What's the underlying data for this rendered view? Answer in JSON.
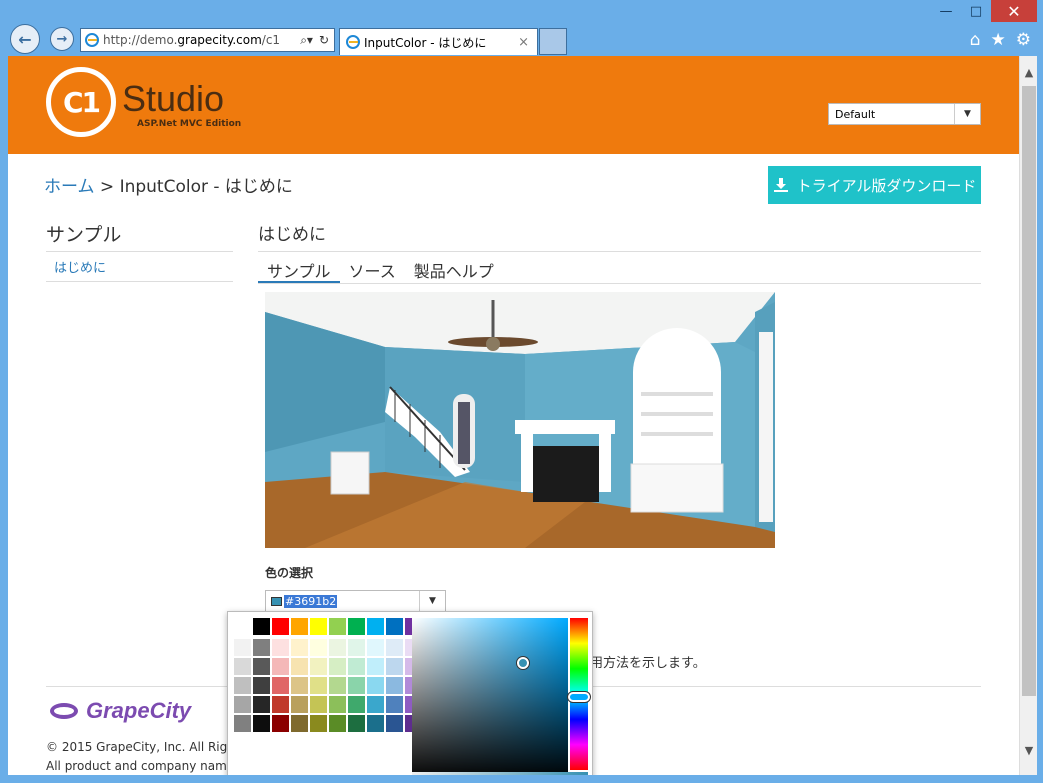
{
  "browser": {
    "url_prefix": "http://demo.",
    "url_domain": "grapecity.com",
    "url_suffix": "/c1",
    "tab_title": "InputColor - はじめに",
    "tab_close": "×"
  },
  "header": {
    "logo_mark": "C1",
    "logo_text": "Studio",
    "logo_edition": "ASP.Net MVC Edition",
    "theme_value": "Default"
  },
  "breadcrumb": {
    "home": "ホーム",
    "separator": " > ",
    "current": "InputColor - はじめに"
  },
  "download_button": "トライアル版ダウンロード",
  "sidebar": {
    "title": "サンプル",
    "items": [
      {
        "label": "はじめに"
      }
    ]
  },
  "main": {
    "title": "はじめに",
    "tabs": [
      {
        "label": "サンプル",
        "active": true
      },
      {
        "label": "ソース",
        "active": false
      },
      {
        "label": "製品ヘルプ",
        "active": false
      }
    ],
    "color_label": "色の選択",
    "color_value": "#3691b2",
    "description_visible": "用方法を示します。"
  },
  "colors": {
    "header_bg": "#ef7a0d",
    "accent_link": "#2a7ab8",
    "download_bg": "#1fc2c9",
    "selected_color": "#3691b2",
    "grapecity": "#7c4bb0"
  },
  "palette": {
    "top_row": [
      "#ffffff",
      "#000000",
      "#ff0000",
      "#ffa500",
      "#ffff00",
      "#92d050",
      "#00b050",
      "#00b0f0",
      "#0070c0",
      "#7030a0"
    ],
    "rows": [
      [
        "#f2f2f2",
        "#7f7f7f",
        "#fde0e0",
        "#fff2cc",
        "#ffffe0",
        "#ebf5e1",
        "#e0f5e9",
        "#e0f7fd",
        "#deebf7",
        "#eadcf4"
      ],
      [
        "#d9d9d9",
        "#595959",
        "#f4b8b8",
        "#f7e3b0",
        "#f2f2c0",
        "#d6eec4",
        "#c0ebd3",
        "#c0eefb",
        "#bdd7ee",
        "#d5bae9"
      ],
      [
        "#bfbfbf",
        "#3f3f3f",
        "#e06666",
        "#dcc487",
        "#e0e088",
        "#b3d88f",
        "#8ad4aa",
        "#8ad8f0",
        "#8bb9e0",
        "#b18ad8"
      ],
      [
        "#a6a6a6",
        "#262626",
        "#c0392b",
        "#b9a05d",
        "#c4c455",
        "#8cbf5a",
        "#3fa96c",
        "#3aa7cc",
        "#4f81bd",
        "#8e5cc2"
      ],
      [
        "#808080",
        "#0d0d0d",
        "#8b0000",
        "#7f6a2e",
        "#8a8a1e",
        "#5a8c26",
        "#1d6e40",
        "#1b6f8c",
        "#2a5592",
        "#5e2d8e"
      ]
    ]
  },
  "footer": {
    "logo_text": "GrapeCity",
    "copyright_line1": "© 2015 GrapeCity, Inc. All Rig",
    "copyright_line2": "All product and company nam"
  }
}
